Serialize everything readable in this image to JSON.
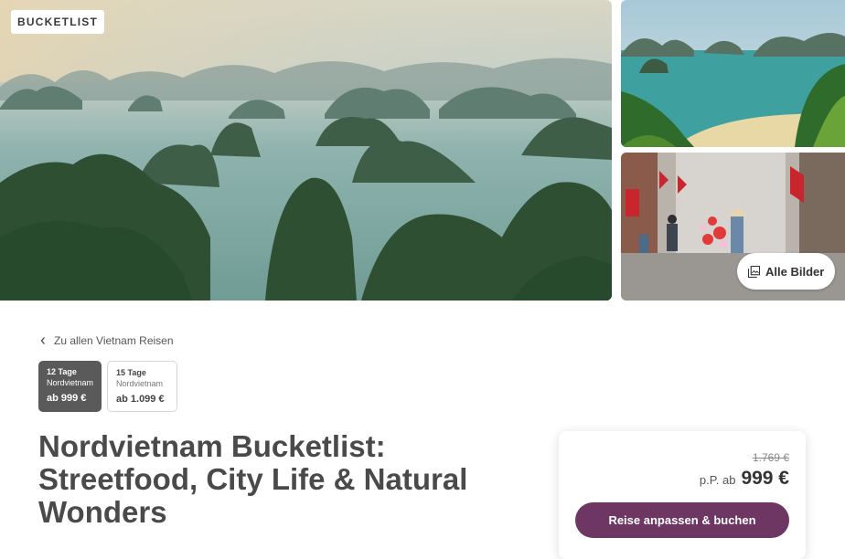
{
  "gallery": {
    "badge": "BUCKETLIST",
    "all_images_label": "Alle Bilder",
    "all_images_icon": "images-icon"
  },
  "back_link": {
    "label": "Zu allen Vietnam Reisen",
    "icon": "chevron-left-icon"
  },
  "variants": [
    {
      "days": "12 Tage",
      "region": "Nordvietnam",
      "price": "ab 999 €",
      "selected": true
    },
    {
      "days": "15 Tage",
      "region": "Nordvietnam",
      "price": "ab 1.099 €",
      "selected": false
    }
  ],
  "trip": {
    "title": "Nordvietnam Bucketlist: Streetfood, City Life & Natural Wonders"
  },
  "pricing": {
    "old_price": "1.769 €",
    "per_person_label": "p.P. ab",
    "price": "999 €",
    "book_label": "Reise anpassen & buchen"
  },
  "colors": {
    "accent": "#6e3663",
    "selected_variant": "#5a5a5a"
  }
}
